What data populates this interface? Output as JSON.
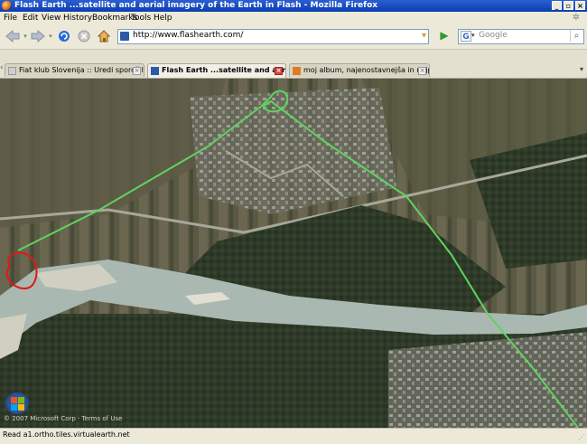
{
  "window": {
    "title": "Flash Earth ...satellite and aerial imagery of the Earth in Flash - Mozilla Firefox",
    "controls": [
      "_",
      "▫",
      "×"
    ]
  },
  "menu": {
    "items": [
      "File",
      "Edit",
      "View",
      "History",
      "Bookmarks",
      "Tools",
      "Help"
    ]
  },
  "navigation": {
    "url": "http://www.flashearth.com/",
    "search_placeholder": "Google",
    "search_engine_letter": "G"
  },
  "tabs": [
    {
      "label": "Fiat klub Slovenija :: Uredi sporočilo",
      "active": false
    },
    {
      "label": "Flash Earth ...satellite and aerial i...",
      "active": true
    },
    {
      "label": "moj album, najenostavnejša in najpriji...",
      "active": false
    }
  ],
  "map": {
    "copyright": "© 2007 Microsoft Corp · Terms of Use",
    "route_color": "#5fd35f",
    "marker_color": "#e01818"
  },
  "status": {
    "text": "Read a1.ortho.tiles.virtualearth.net"
  }
}
